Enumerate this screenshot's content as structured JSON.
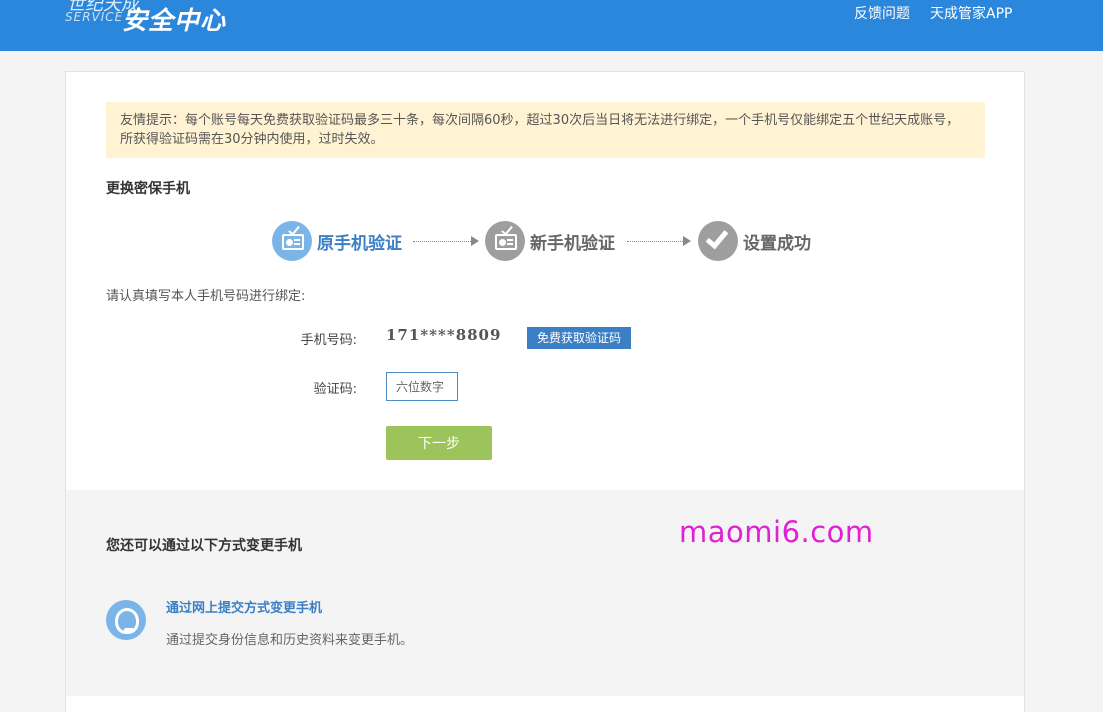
{
  "header": {
    "logo_top": "世纪天成",
    "logo_sub": "SERVICE",
    "logo_main": "安全中心",
    "nav": {
      "feedback": "反馈问题",
      "app": "天成管家APP"
    }
  },
  "notice": "友情提示：每个账号每天免费获取验证码最多三十条，每次间隔60秒，超过30次后当日将无法进行绑定，一个手机号仅能绑定五个世纪天成账号，所获得验证码需在30分钟内使用，过时失效。",
  "section_title": "更换密保手机",
  "steps": [
    {
      "label": "原手机验证",
      "state": "active",
      "icon": "id-card-check-icon"
    },
    {
      "label": "新手机验证",
      "state": "pending",
      "icon": "id-card-check-icon"
    },
    {
      "label": "设置成功",
      "state": "pending",
      "icon": "check-icon"
    }
  ],
  "form": {
    "intro": "请认真填写本人手机号码进行绑定:",
    "phone_label": "手机号码:",
    "phone_value": "171****8809",
    "get_code_label": "免费获取验证码",
    "code_label": "验证码:",
    "code_placeholder": "六位数字",
    "next_label": "下一步"
  },
  "alternative": {
    "title": "您还可以通过以下方式变更手机",
    "link_label": "通过网上提交方式变更手机",
    "description": "通过提交身份信息和历史资料来变更手机。",
    "icon": "customer-service-icon"
  },
  "watermark": "maomi6.com",
  "colors": {
    "header_bg": "#2b87dc",
    "accent_blue": "#3d7fc4",
    "step_active": "#7bb5e8",
    "step_inactive": "#9e9e9e",
    "next_button": "#9dc45a",
    "notice_bg": "#fff3d3",
    "watermark": "#e020d4"
  }
}
